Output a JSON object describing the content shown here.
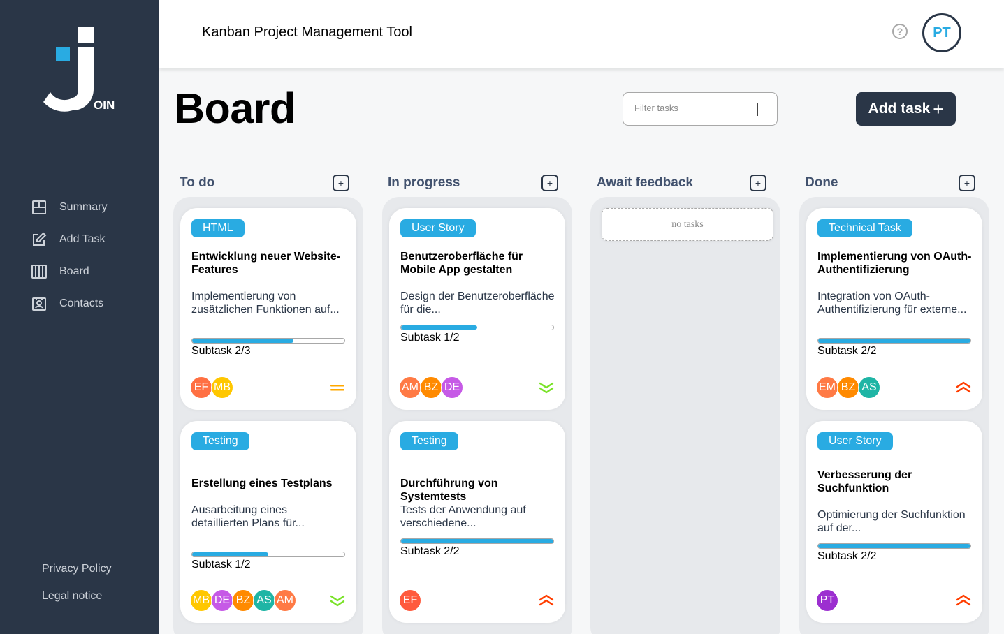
{
  "header": {
    "title": "Kanban Project Management Tool",
    "help": "?",
    "user_initials": "PT"
  },
  "sidebar": {
    "nav": [
      {
        "label": "Summary",
        "icon": "summary-icon"
      },
      {
        "label": "Add Task",
        "icon": "edit-icon"
      },
      {
        "label": "Board",
        "icon": "board-icon"
      },
      {
        "label": "Contacts",
        "icon": "contacts-icon"
      }
    ],
    "legal": [
      "Privacy Policy",
      "Legal notice"
    ]
  },
  "board": {
    "title": "Board",
    "filter_placeholder": "Filter tasks",
    "add_task_label": "Add task",
    "add_task_symbol": "+",
    "no_tasks": "no tasks"
  },
  "columns": [
    {
      "title": "To do",
      "add": "+"
    },
    {
      "title": "In progress",
      "add": "+"
    },
    {
      "title": "Await feedback",
      "add": "+"
    },
    {
      "title": "Done",
      "add": "+"
    }
  ],
  "colors": {
    "sidebar": "#2a3647",
    "badge": "#29abe2",
    "priority_medium": "#ffa800",
    "priority_low": "#7ae229",
    "priority_urgent": "#ff3d00"
  },
  "cards": [
    {
      "col": 0,
      "badge": "HTML",
      "title": "Entwicklung neuer Website-Features",
      "desc": "Implementierung von zusätzlichen Funktionen auf...",
      "subtask": "Subtask 2/3",
      "progress": 0.667,
      "priority": "medium",
      "assignees": [
        {
          "i": "EF",
          "c": "#ff7043"
        },
        {
          "i": "MB",
          "c": "#ffc700"
        }
      ]
    },
    {
      "col": 0,
      "badge": "Testing",
      "title": "Erstellung eines Testplans",
      "desc": "Ausarbeitung eines detaillierten Plans für...",
      "subtask": "Subtask 1/2",
      "progress": 0.5,
      "priority": "low",
      "assignees": [
        {
          "i": "MB",
          "c": "#ffc700"
        },
        {
          "i": "DE",
          "c": "#c65ae6"
        },
        {
          "i": "BZ",
          "c": "#ff8a00"
        },
        {
          "i": "AS",
          "c": "#1fb5a5"
        },
        {
          "i": "AM",
          "c": "#ff7a45"
        }
      ]
    },
    {
      "col": 1,
      "badge": "User Story",
      "title": "Benutzeroberfläche für Mobile App gestalten",
      "desc": "Design der Benutzeroberfläche für die...",
      "subtask": "Subtask 1/2",
      "progress": 0.5,
      "priority": "low",
      "assignees": [
        {
          "i": "AM",
          "c": "#ff7a45"
        },
        {
          "i": "BZ",
          "c": "#ff8a00"
        },
        {
          "i": "DE",
          "c": "#c65ae6"
        }
      ]
    },
    {
      "col": 1,
      "badge": "Testing",
      "title": "Durchführung von Systemtests",
      "desc": "Tests der Anwendung auf verschiedene...",
      "subtask": "Subtask 2/2",
      "progress": 1.0,
      "priority": "urgent",
      "assignees": [
        {
          "i": "EF",
          "c": "#ff5a3d"
        }
      ]
    },
    {
      "col": 3,
      "badge": "Technical Task",
      "title": "Implementierung von OAuth-Authentifizierung",
      "desc": "Integration von OAuth-Authentifizierung für externe...",
      "subtask": "Subtask 2/2",
      "progress": 1.0,
      "priority": "urgent",
      "assignees": [
        {
          "i": "EM",
          "c": "#ff7a45"
        },
        {
          "i": "BZ",
          "c": "#ff8a00"
        },
        {
          "i": "AS",
          "c": "#1fb5a5"
        }
      ]
    },
    {
      "col": 3,
      "badge": "User Story",
      "title": "Verbesserung der Suchfunktion",
      "desc": "Optimierung der Suchfunktion auf der...",
      "subtask": "Subtask 2/2",
      "progress": 1.0,
      "priority": "urgent",
      "assignees": [
        {
          "i": "PT",
          "c": "#9c2fd0"
        }
      ]
    }
  ]
}
